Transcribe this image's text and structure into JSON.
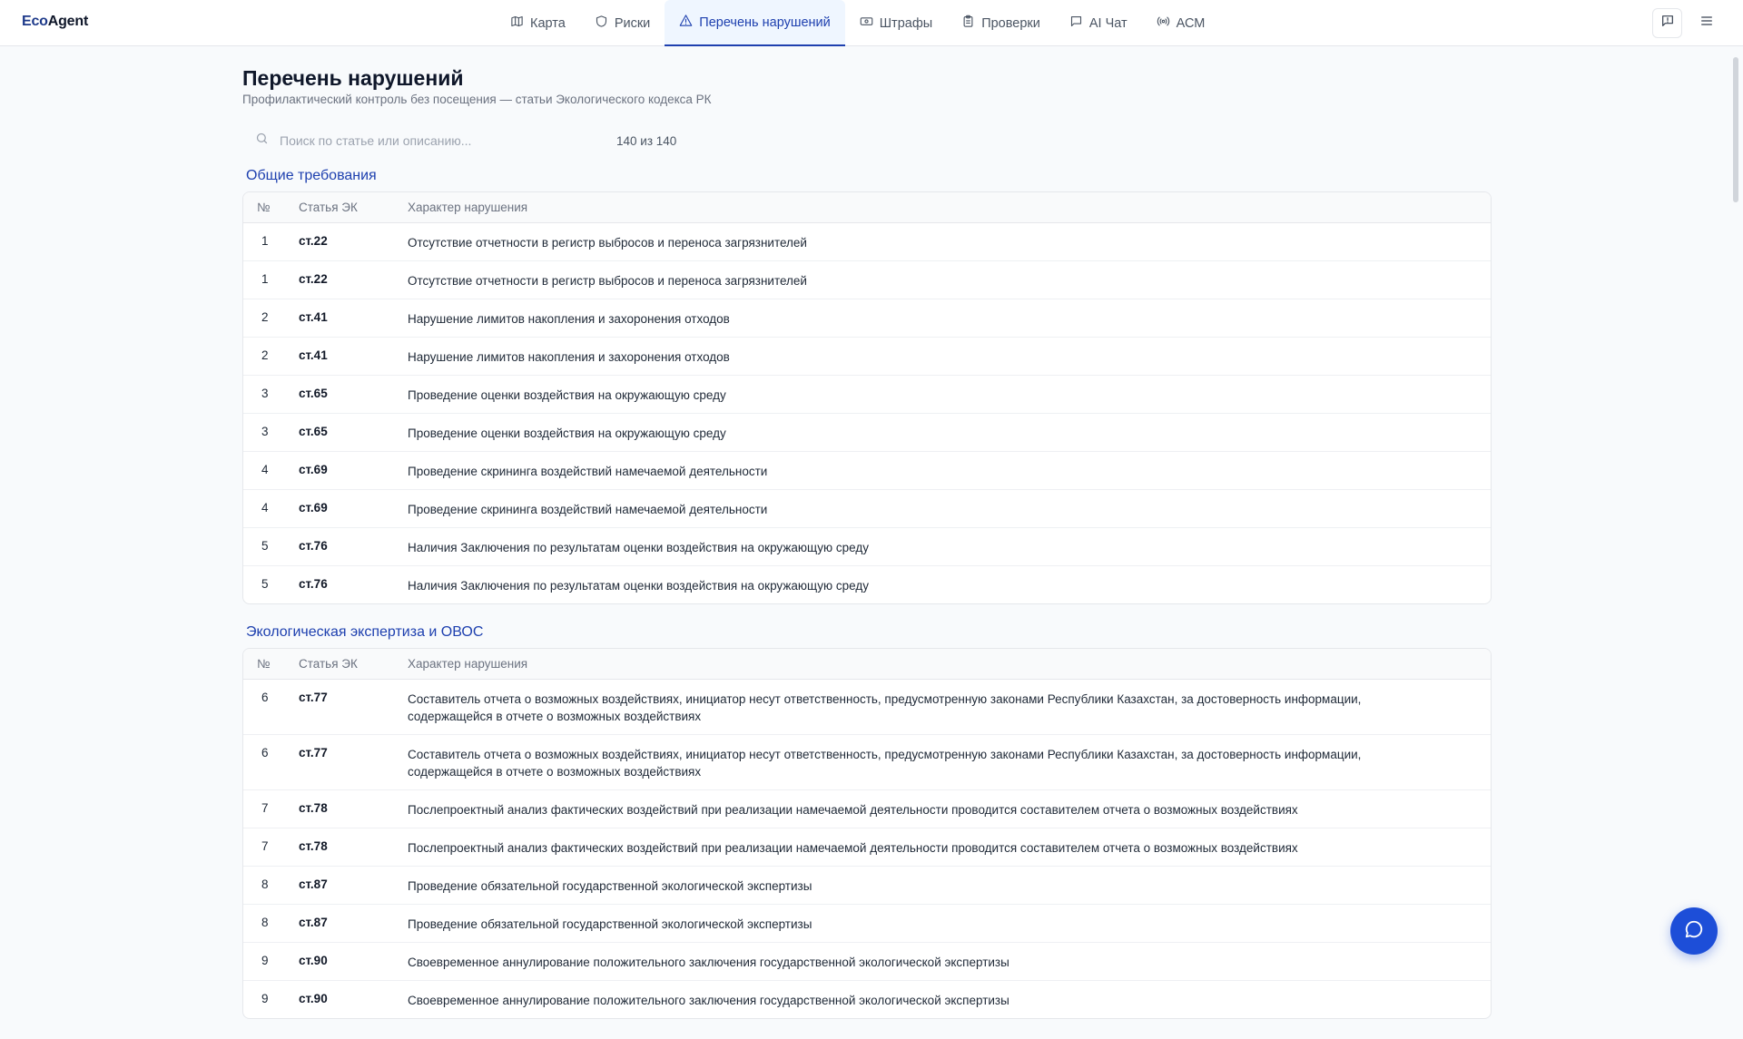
{
  "brand": {
    "part1": "Eco",
    "part2": "Agent"
  },
  "nav": [
    {
      "label": "Карта",
      "icon": "map-icon",
      "active": false
    },
    {
      "label": "Риски",
      "icon": "shield-icon",
      "active": false
    },
    {
      "label": "Перечень нарушений",
      "icon": "warning-icon",
      "active": true
    },
    {
      "label": "Штрафы",
      "icon": "banknote-icon",
      "active": false
    },
    {
      "label": "Проверки",
      "icon": "clipboard-icon",
      "active": false
    },
    {
      "label": "AI Чат",
      "icon": "message-icon",
      "active": false
    },
    {
      "label": "АСМ",
      "icon": "broadcast-icon",
      "active": false
    }
  ],
  "header_actions": [
    {
      "icon": "feedback-icon"
    },
    {
      "icon": "menu-icon"
    }
  ],
  "page": {
    "title": "Перечень нарушений",
    "subtitle": "Профилактический контроль без посещения — статьи Экологического кодекса РК"
  },
  "search": {
    "placeholder": "Поиск по статье или описанию...",
    "value": "",
    "count": "140 из 140"
  },
  "table_headers": {
    "num": "№",
    "article": "Статья ЭК",
    "desc": "Характер нарушения"
  },
  "sections": [
    {
      "title": "Общие требования",
      "rows": [
        {
          "num": "1",
          "article": "ст.22",
          "desc": "Отсутствие отчетности в регистр выбросов и переноса загрязнителей"
        },
        {
          "num": "1",
          "article": "ст.22",
          "desc": "Отсутствие отчетности в регистр выбросов и переноса загрязнителей"
        },
        {
          "num": "2",
          "article": "ст.41",
          "desc": "Нарушение лимитов накопления и захоронения отходов"
        },
        {
          "num": "2",
          "article": "ст.41",
          "desc": "Нарушение лимитов накопления и захоронения отходов"
        },
        {
          "num": "3",
          "article": "ст.65",
          "desc": "Проведение оценки воздействия на окружающую среду"
        },
        {
          "num": "3",
          "article": "ст.65",
          "desc": "Проведение оценки воздействия на окружающую среду"
        },
        {
          "num": "4",
          "article": "ст.69",
          "desc": "Проведение скрининга воздействий намечаемой деятельности"
        },
        {
          "num": "4",
          "article": "ст.69",
          "desc": "Проведение скрининга воздействий намечаемой деятельности"
        },
        {
          "num": "5",
          "article": "ст.76",
          "desc": "Наличия Заключения по результатам оценки воздействия на окружающую среду"
        },
        {
          "num": "5",
          "article": "ст.76",
          "desc": "Наличия Заключения по результатам оценки воздействия на окружающую среду"
        }
      ]
    },
    {
      "title": "Экологическая экспертиза и ОВОС",
      "rows": [
        {
          "num": "6",
          "article": "ст.77",
          "desc": "Составитель отчета о возможных воздействиях, инициатор несут ответственность, предусмотренную законами Республики Казахстан, за достоверность информации, содержащейся в отчете о возможных воздействиях"
        },
        {
          "num": "6",
          "article": "ст.77",
          "desc": "Составитель отчета о возможных воздействиях, инициатор несут ответственность, предусмотренную законами Республики Казахстан, за достоверность информации, содержащейся в отчете о возможных воздействиях"
        },
        {
          "num": "7",
          "article": "ст.78",
          "desc": "Послепроектный анализ фактических воздействий при реализации намечаемой деятельности проводится составителем отчета о возможных воздействиях"
        },
        {
          "num": "7",
          "article": "ст.78",
          "desc": "Послепроектный анализ фактических воздействий при реализации намечаемой деятельности проводится составителем отчета о возможных воздействиях"
        },
        {
          "num": "8",
          "article": "ст.87",
          "desc": "Проведение обязательной государственной экологической экспертизы"
        },
        {
          "num": "8",
          "article": "ст.87",
          "desc": "Проведение обязательной государственной экологической экспертизы"
        },
        {
          "num": "9",
          "article": "ст.90",
          "desc": "Своевременное аннулирование положительного заключения государственной экологической экспертизы"
        },
        {
          "num": "9",
          "article": "ст.90",
          "desc": "Своевременное аннулирование положительного заключения государственной экологической экспертизы"
        }
      ]
    }
  ],
  "colors": {
    "accent": "#1e40af",
    "fab": "#1d4ed8",
    "background": "#f8fafc"
  },
  "fab": {
    "icon": "chat-bubble-icon"
  }
}
